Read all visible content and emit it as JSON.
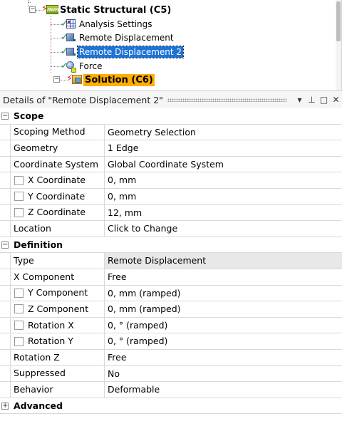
{
  "tree": {
    "items": [
      {
        "label": "Static Structural (C5)",
        "icon": "static-structural-icon",
        "status": "check"
      },
      {
        "label": "Analysis Settings",
        "icon": "analysis-settings-icon",
        "status": "check"
      },
      {
        "label": "Remote Displacement",
        "icon": "remote-displacement-icon",
        "status": "check"
      },
      {
        "label": "Remote Displacement 2",
        "icon": "remote-displacement-icon",
        "status": "check"
      },
      {
        "label": "Force",
        "icon": "force-icon",
        "status": "check"
      },
      {
        "label": "Solution (C6)",
        "icon": "solution-icon",
        "status": "lightning"
      }
    ],
    "static_badge": "mm",
    "selected_color": "#1e73d6",
    "solution_color": "#ffae00"
  },
  "details": {
    "title": "Details of \"Remote Displacement 2\"",
    "buttons": {
      "dropdown": "▾",
      "pin": "⊥",
      "maximize": "□",
      "close": "✕"
    },
    "groups": [
      {
        "label": "Scope",
        "expanded": true,
        "rows": [
          {
            "name": "Scoping Method",
            "value": "Geometry Selection",
            "checkbox": false,
            "shaded": false
          },
          {
            "name": "Geometry",
            "value": "1 Edge",
            "checkbox": false,
            "shaded": false
          },
          {
            "name": "Coordinate System",
            "value": "Global Coordinate System",
            "checkbox": false,
            "shaded": false
          },
          {
            "name": "X Coordinate",
            "value": "0, mm",
            "checkbox": true,
            "shaded": false
          },
          {
            "name": "Y Coordinate",
            "value": "0, mm",
            "checkbox": true,
            "shaded": false
          },
          {
            "name": "Z Coordinate",
            "value": "12, mm",
            "checkbox": true,
            "shaded": false
          },
          {
            "name": "Location",
            "value": "Click to Change",
            "checkbox": false,
            "shaded": false
          }
        ]
      },
      {
        "label": "Definition",
        "expanded": true,
        "rows": [
          {
            "name": "Type",
            "value": "Remote Displacement",
            "checkbox": false,
            "shaded": true
          },
          {
            "name": "X Component",
            "value": "Free",
            "checkbox": false,
            "shaded": false
          },
          {
            "name": "Y Component",
            "value": "0, mm  (ramped)",
            "checkbox": true,
            "shaded": false
          },
          {
            "name": "Z Component",
            "value": "0, mm  (ramped)",
            "checkbox": true,
            "shaded": false
          },
          {
            "name": "Rotation X",
            "value": "0, °  (ramped)",
            "checkbox": true,
            "shaded": false
          },
          {
            "name": "Rotation Y",
            "value": "0, °  (ramped)",
            "checkbox": true,
            "shaded": false
          },
          {
            "name": "Rotation Z",
            "value": "Free",
            "checkbox": false,
            "shaded": false
          },
          {
            "name": "Suppressed",
            "value": "No",
            "checkbox": false,
            "shaded": false
          },
          {
            "name": "Behavior",
            "value": "Deformable",
            "checkbox": false,
            "shaded": false
          }
        ]
      },
      {
        "label": "Advanced",
        "expanded": false,
        "rows": []
      }
    ]
  }
}
